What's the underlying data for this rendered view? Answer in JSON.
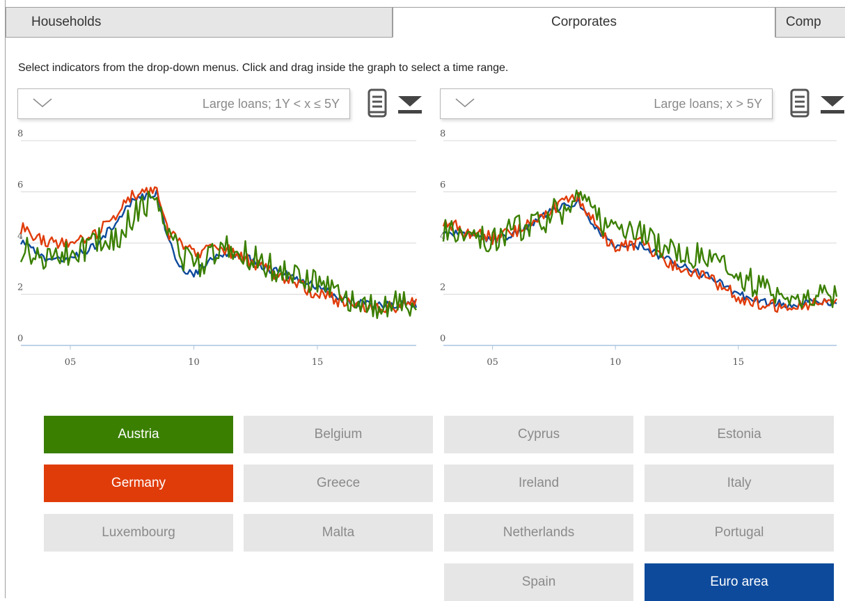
{
  "tabs": [
    {
      "label": "Households",
      "active": false
    },
    {
      "label": "Corporates",
      "active": true
    },
    {
      "label": "Comp",
      "active": false
    }
  ],
  "instructions": "Select indicators from the drop-down menus. Click and drag inside the graph to select a time range.",
  "charts": [
    {
      "indicator": "Large loans; 1Y < x ≤ 5Y",
      "icons": [
        "book-icon",
        "download-icon"
      ],
      "chart_data": {
        "type": "line",
        "title": "",
        "xlabel": "",
        "ylabel": "",
        "xlim": [
          2003,
          2019
        ],
        "ylim": [
          0,
          8
        ],
        "yticks": [
          "0",
          "2",
          "4",
          "6",
          "8"
        ],
        "xticks": [
          {
            "value": 2005,
            "label": "05"
          },
          {
            "value": 2010,
            "label": "10"
          },
          {
            "value": 2015,
            "label": "15"
          }
        ],
        "grid": true,
        "series": [
          {
            "name": "Euro area",
            "color": "#0d4a9c",
            "x": [
              2003,
              2004,
              2005,
              2006,
              2007,
              2007.5,
              2008,
              2008.5,
              2009,
              2009.5,
              2010,
              2011,
              2012,
              2013,
              2014,
              2015,
              2016,
              2017,
              2018,
              2019
            ],
            "y": [
              4.1,
              3.3,
              3.4,
              3.9,
              5.0,
              5.6,
              5.8,
              6.0,
              4.0,
              3.0,
              2.8,
              3.6,
              3.5,
              3.0,
              2.7,
              2.3,
              1.8,
              1.6,
              1.6,
              1.6
            ]
          },
          {
            "name": "Germany",
            "color": "#e03c0a",
            "x": [
              2003,
              2004,
              2005,
              2006,
              2007,
              2007.5,
              2008,
              2008.5,
              2009,
              2009.5,
              2010,
              2011,
              2012,
              2013,
              2014,
              2015,
              2016,
              2017,
              2018,
              2019
            ],
            "y": [
              4.6,
              4.0,
              4.0,
              4.3,
              5.3,
              5.8,
              5.9,
              6.1,
              4.3,
              4.0,
              3.6,
              3.9,
              3.4,
              2.9,
              2.5,
              2.0,
              1.7,
              1.5,
              1.5,
              1.7
            ]
          },
          {
            "name": "Austria",
            "color": "#3a7f00",
            "x": [
              2003,
              2004,
              2005,
              2006,
              2007,
              2007.5,
              2008,
              2008.5,
              2009,
              2009.5,
              2010,
              2011,
              2012,
              2013,
              2014,
              2015,
              2016,
              2017,
              2018,
              2019
            ],
            "y": [
              3.8,
              3.5,
              3.6,
              4.0,
              4.3,
              5.0,
              5.5,
              5.8,
              4.6,
              3.5,
              3.0,
              3.8,
              3.6,
              3.1,
              2.9,
              2.4,
              1.9,
              1.6,
              1.6,
              1.5
            ]
          }
        ]
      }
    },
    {
      "indicator": "Large loans; x > 5Y",
      "icons": [
        "book-icon",
        "download-icon"
      ],
      "chart_data": {
        "type": "line",
        "title": "",
        "xlabel": "",
        "ylabel": "",
        "xlim": [
          2003,
          2019
        ],
        "ylim": [
          0,
          8
        ],
        "yticks": [
          "0",
          "2",
          "4",
          "6",
          "8"
        ],
        "xticks": [
          {
            "value": 2005,
            "label": "05"
          },
          {
            "value": 2010,
            "label": "10"
          },
          {
            "value": 2015,
            "label": "15"
          }
        ],
        "grid": true,
        "series": [
          {
            "name": "Euro area",
            "color": "#0d4a9c",
            "x": [
              2003,
              2004,
              2005,
              2006,
              2007,
              2007.5,
              2008,
              2008.5,
              2009,
              2009.5,
              2010,
              2011,
              2012,
              2013,
              2014,
              2015,
              2016,
              2017,
              2018,
              2019
            ],
            "y": [
              4.5,
              4.3,
              4.1,
              4.4,
              5.0,
              5.3,
              5.5,
              5.6,
              4.9,
              4.3,
              3.8,
              3.9,
              3.4,
              3.0,
              2.6,
              2.0,
              1.7,
              1.6,
              1.7,
              1.7
            ]
          },
          {
            "name": "Germany",
            "color": "#e03c0a",
            "x": [
              2003,
              2004,
              2005,
              2006,
              2007,
              2007.5,
              2008,
              2008.5,
              2009,
              2009.5,
              2010,
              2011,
              2012,
              2013,
              2014,
              2015,
              2016,
              2017,
              2018,
              2019
            ],
            "y": [
              4.9,
              4.4,
              4.2,
              4.5,
              5.1,
              5.4,
              5.6,
              5.8,
              5.0,
              4.3,
              3.8,
              4.0,
              3.3,
              2.9,
              2.5,
              1.9,
              1.6,
              1.5,
              1.6,
              1.6
            ]
          },
          {
            "name": "Austria",
            "color": "#3a7f00",
            "x": [
              2003,
              2004,
              2005,
              2006,
              2007,
              2007.5,
              2008,
              2008.5,
              2009,
              2009.5,
              2010,
              2011,
              2012,
              2013,
              2014,
              2015,
              2016,
              2017,
              2018,
              2019
            ],
            "y": [
              4.6,
              4.3,
              4.0,
              4.6,
              4.8,
              5.2,
              5.3,
              5.6,
              5.3,
              4.8,
              4.3,
              4.4,
              3.9,
              3.6,
              3.4,
              2.8,
              2.2,
              2.0,
              1.9,
              1.8
            ]
          }
        ]
      }
    }
  ],
  "countries": [
    {
      "label": "Austria",
      "selected": true,
      "color": "#3a7f00"
    },
    {
      "label": "Belgium",
      "selected": false
    },
    {
      "label": "Cyprus",
      "selected": false
    },
    {
      "label": "Estonia",
      "selected": false
    },
    {
      "label": "Germany",
      "selected": true,
      "color": "#e03c0a"
    },
    {
      "label": "Greece",
      "selected": false
    },
    {
      "label": "Ireland",
      "selected": false
    },
    {
      "label": "Italy",
      "selected": false
    },
    {
      "label": "Luxembourg",
      "selected": false
    },
    {
      "label": "Malta",
      "selected": false
    },
    {
      "label": "Netherlands",
      "selected": false
    },
    {
      "label": "Portugal",
      "selected": false
    },
    {
      "label": "Spain",
      "selected": false
    },
    {
      "label": "Euro area",
      "selected": true,
      "color": "#0d4a9c"
    }
  ]
}
